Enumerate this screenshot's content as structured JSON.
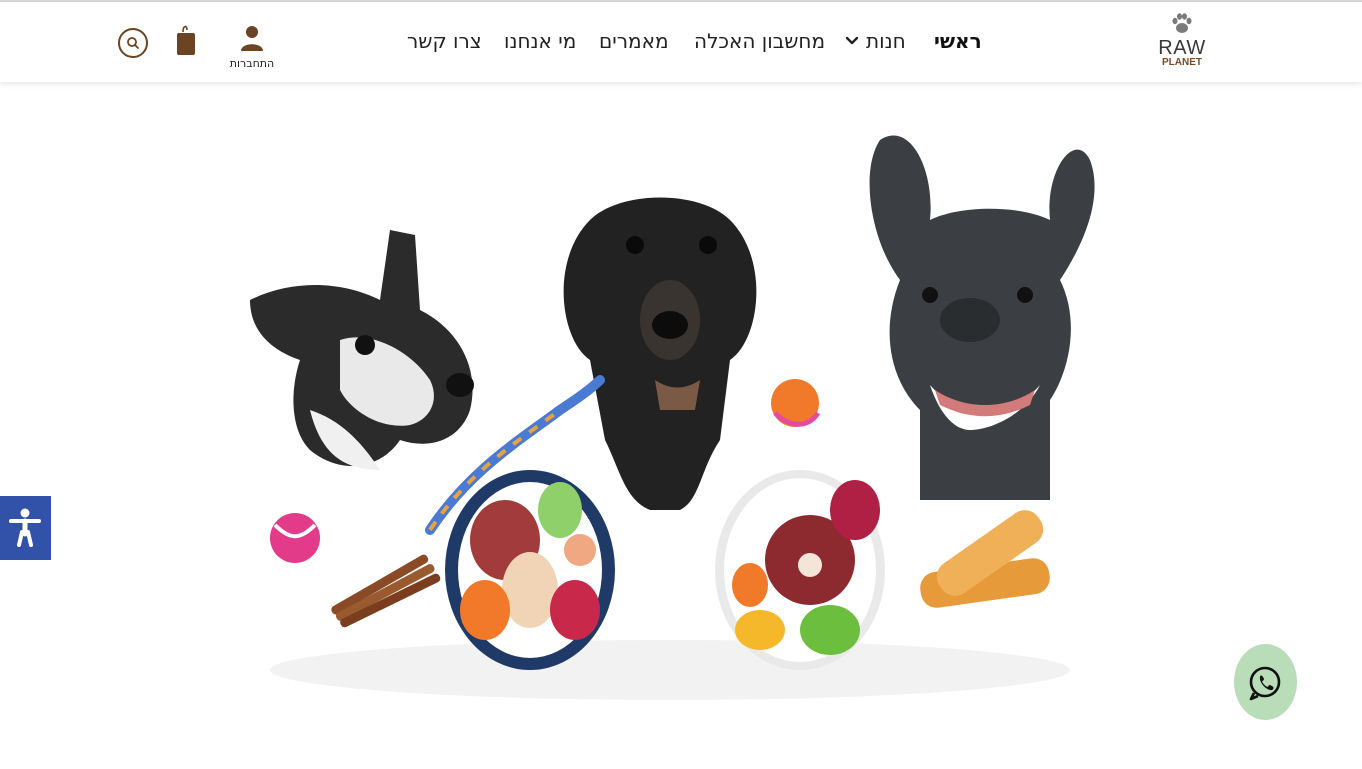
{
  "header": {
    "logo": {
      "line1": "RAW",
      "line2": "PLANET"
    },
    "nav": [
      {
        "label": "ראשי",
        "active": true
      },
      {
        "label": "חנות",
        "has_dropdown": true
      },
      {
        "label": "מחשבון האכלה"
      },
      {
        "label": "מאמרים"
      },
      {
        "label": "מי אנחנו"
      },
      {
        "label": "צרו קשר"
      }
    ],
    "login_label": "התחברות",
    "icons": [
      "user-icon",
      "shopping-bag-icon",
      "search-icon"
    ]
  },
  "hero": {
    "subject": "three dogs looking up behind bowls of raw food with toys and chews"
  },
  "floating": {
    "accessibility_icon": "accessibility-icon",
    "whatsapp_icon": "whatsapp-icon"
  },
  "colors": {
    "brand_brown": "#6b4423",
    "accessibility_blue": "#3251a8",
    "whatsapp_green": "#b9dcb9"
  }
}
